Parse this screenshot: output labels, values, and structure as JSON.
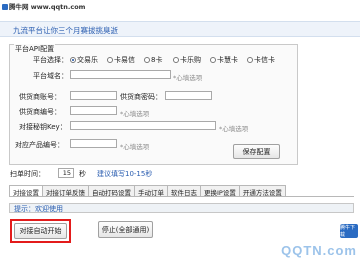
{
  "watermark": {
    "top_text": "腾牛网 www.qqtn.com",
    "bottom_logo": "腾牛下载",
    "bottom_text": "QQTN.com"
  },
  "banner": {
    "text": "九流平台让你三个月赛拔挑臭逝"
  },
  "platform": {
    "group_title": "平台API配置",
    "select_label": "平台选择：",
    "options": [
      "交易乐",
      "卡易信",
      "8卡",
      "卡乐购",
      "卡慧卡",
      "卡信卡"
    ],
    "selected": "交易乐",
    "name_label": "平台域名：",
    "name_hint": "*心填选项",
    "supplier_account_label": "供货商账号：",
    "supplier_password_label": "供货商密码：",
    "supplier_id_label": "供货商编号：",
    "supplier_id_hint": "*心填选项",
    "key_label": "对接秘钥Key：",
    "key_hint": "*心填选项",
    "product_id_label": "对应产品编号：",
    "product_id_hint": "*心填选项",
    "save_button": "保存配置"
  },
  "scan": {
    "label": "扫单时间：",
    "value": "15",
    "unit": "秒",
    "hint": "建议填写10-15秒"
  },
  "tabs": [
    "对接设置",
    "对接订单反馈",
    "自动打码设置",
    "手动订单",
    "软件日志",
    "更换IP设置",
    "开通方法设置"
  ],
  "notice": {
    "text": "提示：欢迎使用"
  },
  "actions": {
    "start_label": "对接自动开始",
    "stop_label": "停止(全部通用)"
  }
}
